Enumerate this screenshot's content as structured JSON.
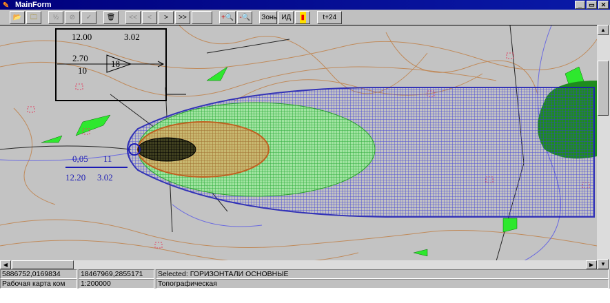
{
  "window": {
    "title": "MainForm",
    "minimize": "_",
    "maximize": "▭",
    "close": "✕"
  },
  "toolbar": {
    "open": "📂",
    "folder": "🗀",
    "calc": "½",
    "cancel": "⊘",
    "ok": "✓",
    "delete": "🗑",
    "first": "<<",
    "prev": "<",
    "next": ">",
    "last": ">>",
    "blank": "",
    "zoom_in": "+",
    "zoom_out": "-",
    "zones": "Зоны",
    "id": "ИД",
    "color": "▮",
    "t24": "t+24"
  },
  "map": {
    "legend_box": {
      "top_left": "12.00",
      "top_right": "3.02",
      "mid": "2.70",
      "bottom": "10",
      "arrow_value": "18"
    },
    "source_label": {
      "top_left": "0,05",
      "top_right": "11",
      "bottom_left": "12.20",
      "bottom_right": "3.02"
    },
    "colors": {
      "outer": "#1a1ab4",
      "middle": "#5ce65c",
      "inner": "#c06020",
      "core": "#000000",
      "forest": "#1e8c1e"
    }
  },
  "status": {
    "row1": {
      "x": "5886752,0169834",
      "y": "18467969,2855171",
      "selected": "Selected: ГОРИЗОНТАЛИ ОСНОВНЫЕ"
    },
    "row2": {
      "map": "Рабочая карта ком",
      "scale": "1:200000",
      "type": "Топографическая"
    }
  }
}
